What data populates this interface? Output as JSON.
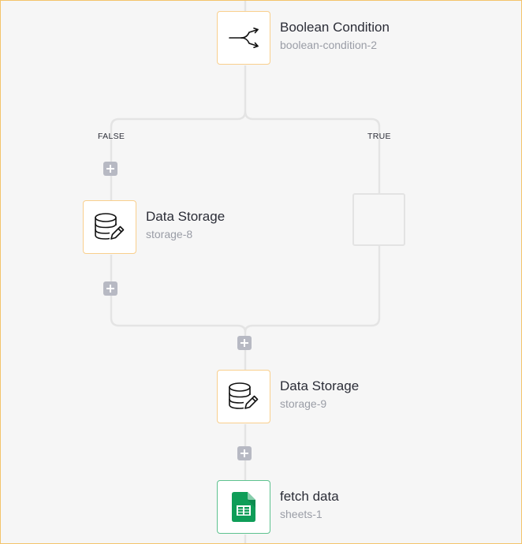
{
  "nodes": {
    "boolean_condition": {
      "title": "Boolean Condition",
      "subtitle": "boolean-condition-2",
      "icon": "branch-icon"
    },
    "storage_8": {
      "title": "Data Storage",
      "subtitle": "storage-8",
      "icon": "database-edit-icon"
    },
    "storage_9": {
      "title": "Data Storage",
      "subtitle": "storage-9",
      "icon": "database-edit-icon"
    },
    "sheets_1": {
      "title": "fetch data",
      "subtitle": "sheets-1",
      "icon": "google-sheets-icon"
    }
  },
  "branches": {
    "false_label": "FALSE",
    "true_label": "TRUE"
  },
  "colors": {
    "node_border": "#f9cf8d",
    "sheets_border": "#5ec28f",
    "connector": "#e4e4e4",
    "add_button": "#b7b9c3",
    "sheets_green": "#0f9d58"
  }
}
